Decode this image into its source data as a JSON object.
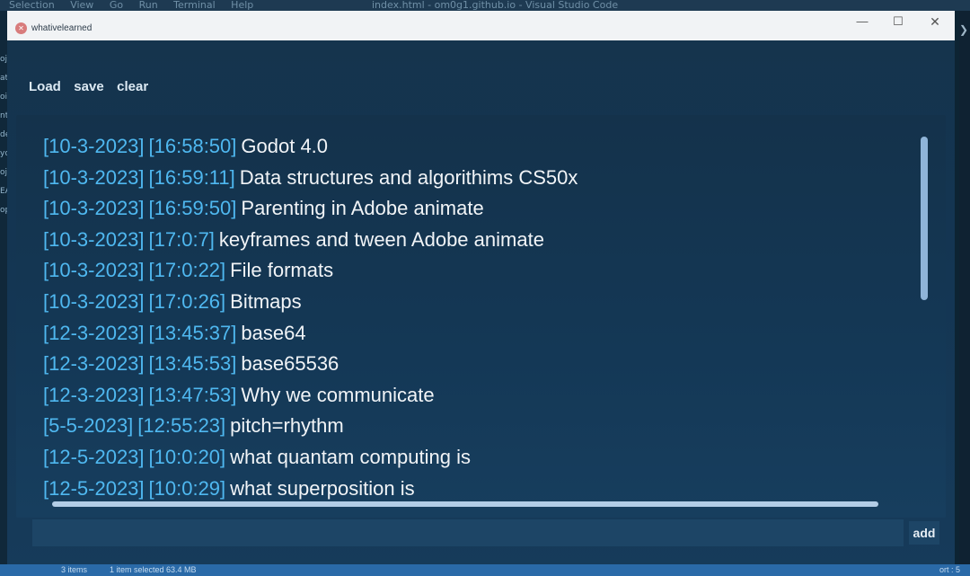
{
  "background": {
    "menu": [
      "Selection",
      "View",
      "Go",
      "Run",
      "Terminal",
      "Help"
    ],
    "vscode_title": "index.html - om0g1.github.io - Visual Studio Code",
    "sidebar_fragments": [
      "oj",
      "ati",
      "oi",
      "nt",
      "de",
      "yo",
      "oj",
      "EAI",
      "op"
    ],
    "status_items": "3 items",
    "status_selected": "1 item selected  63.4 MB",
    "status_right": "ort : 5"
  },
  "window": {
    "title": "whativelearned",
    "controls": {
      "minimize": "—",
      "maximize": "☐",
      "close": "✕"
    }
  },
  "toolbar": {
    "load_label": "Load",
    "save_label": "save",
    "clear_label": "clear"
  },
  "entries": [
    {
      "date": "[10-3-2023]",
      "time": "[16:58:50]",
      "text": "Godot 4.0"
    },
    {
      "date": "[10-3-2023]",
      "time": "[16:59:11]",
      "text": "Data structures and algorithims CS50x"
    },
    {
      "date": "[10-3-2023]",
      "time": "[16:59:50]",
      "text": "Parenting in Adobe animate"
    },
    {
      "date": "[10-3-2023]",
      "time": "[17:0:7]",
      "text": "keyframes and tween Adobe animate"
    },
    {
      "date": "[10-3-2023]",
      "time": "[17:0:22]",
      "text": "File formats"
    },
    {
      "date": "[10-3-2023]",
      "time": "[17:0:26]",
      "text": "Bitmaps"
    },
    {
      "date": "[12-3-2023]",
      "time": "[13:45:37]",
      "text": "base64"
    },
    {
      "date": "[12-3-2023]",
      "time": "[13:45:53]",
      "text": "base65536"
    },
    {
      "date": "[12-3-2023]",
      "time": "[13:47:53]",
      "text": "Why we communicate"
    },
    {
      "date": "[5-5-2023]",
      "time": "[12:55:23]",
      "text": "pitch=rhythm"
    },
    {
      "date": "[12-5-2023]",
      "time": "[10:0:20]",
      "text": "what quantam computing is"
    },
    {
      "date": "[12-5-2023]",
      "time": "[10:0:29]",
      "text": "what superposition is"
    }
  ],
  "input": {
    "value": "",
    "placeholder": ""
  },
  "add_label": "add",
  "colors": {
    "timestamp": "#4fb8f0",
    "entry_text": "#f1f4f7",
    "panel": "#14324b"
  }
}
